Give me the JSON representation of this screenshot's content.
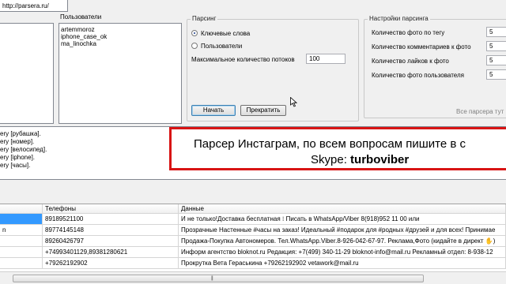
{
  "address": {
    "url": "http://parsera.ru/"
  },
  "users": {
    "legend": "Пользователи",
    "items": [
      "artemmoroz",
      "iphone_case_ok",
      "ma_linochka"
    ]
  },
  "parsing": {
    "legend": "Парсинг",
    "radio_keywords": "Ключевые слова",
    "radio_users": "Пользователи",
    "max_threads_label": "Максимальное количество потоков",
    "max_threads_value": "100",
    "start_button": "Начать",
    "stop_button": "Прекратить"
  },
  "settings": {
    "legend": "Настройки парсинга",
    "rows": [
      {
        "label": "Количество фото по тегу",
        "value": "5"
      },
      {
        "label": "Количество комментариев к фото",
        "value": "5"
      },
      {
        "label": "Количество лайков к фото",
        "value": "5"
      },
      {
        "label": "Количество фото пользователя",
        "value": "5"
      }
    ],
    "footer_text": "Все парсера тут"
  },
  "log": {
    "lines": [
      "ery [рубашка].",
      "ery [номер].",
      "ery [велосипед].",
      "ery [iphone].",
      "ery [часы]."
    ]
  },
  "overlay": {
    "line1": "Парсер Инстаграм, по всем вопросам пишите в с",
    "line2_prefix": "Skype: ",
    "line2_bold": "turboviber"
  },
  "table": {
    "headers": [
      "Телефоны",
      "Данные"
    ],
    "rows": [
      {
        "c0": "",
        "phone": "89189521100",
        "data": "И не только!Доставка бесплатная ⁝ Писать в WhatsApp/Viber 8(918)952 11 00 или"
      },
      {
        "c0": "n",
        "phone": "89774145148",
        "data": "Прозрачные Настенные #часы на заказ! Идеальный #подарок для #родных #друзей и для всех! Принимае"
      },
      {
        "c0": "",
        "phone": "89260426797",
        "data": "Продажа-Покупка Автономеров. Тел.WhatsApp.Viber.8-926-042-67-97. Реклама,Фото (кидайте в директ ✋)"
      },
      {
        "c0": "",
        "phone": "+74993401129,89381280621",
        "data": "Информ агентство bloknot.ru Редакция: +7(499) 340-11-29 bloknot-info@mail.ru Рекламный отдел: 8-938-12"
      },
      {
        "c0": "",
        "phone": "+79262192902",
        "data": "Прокрутка Вета Гераськина +79262192902 vetawork@mail.ru"
      }
    ]
  }
}
